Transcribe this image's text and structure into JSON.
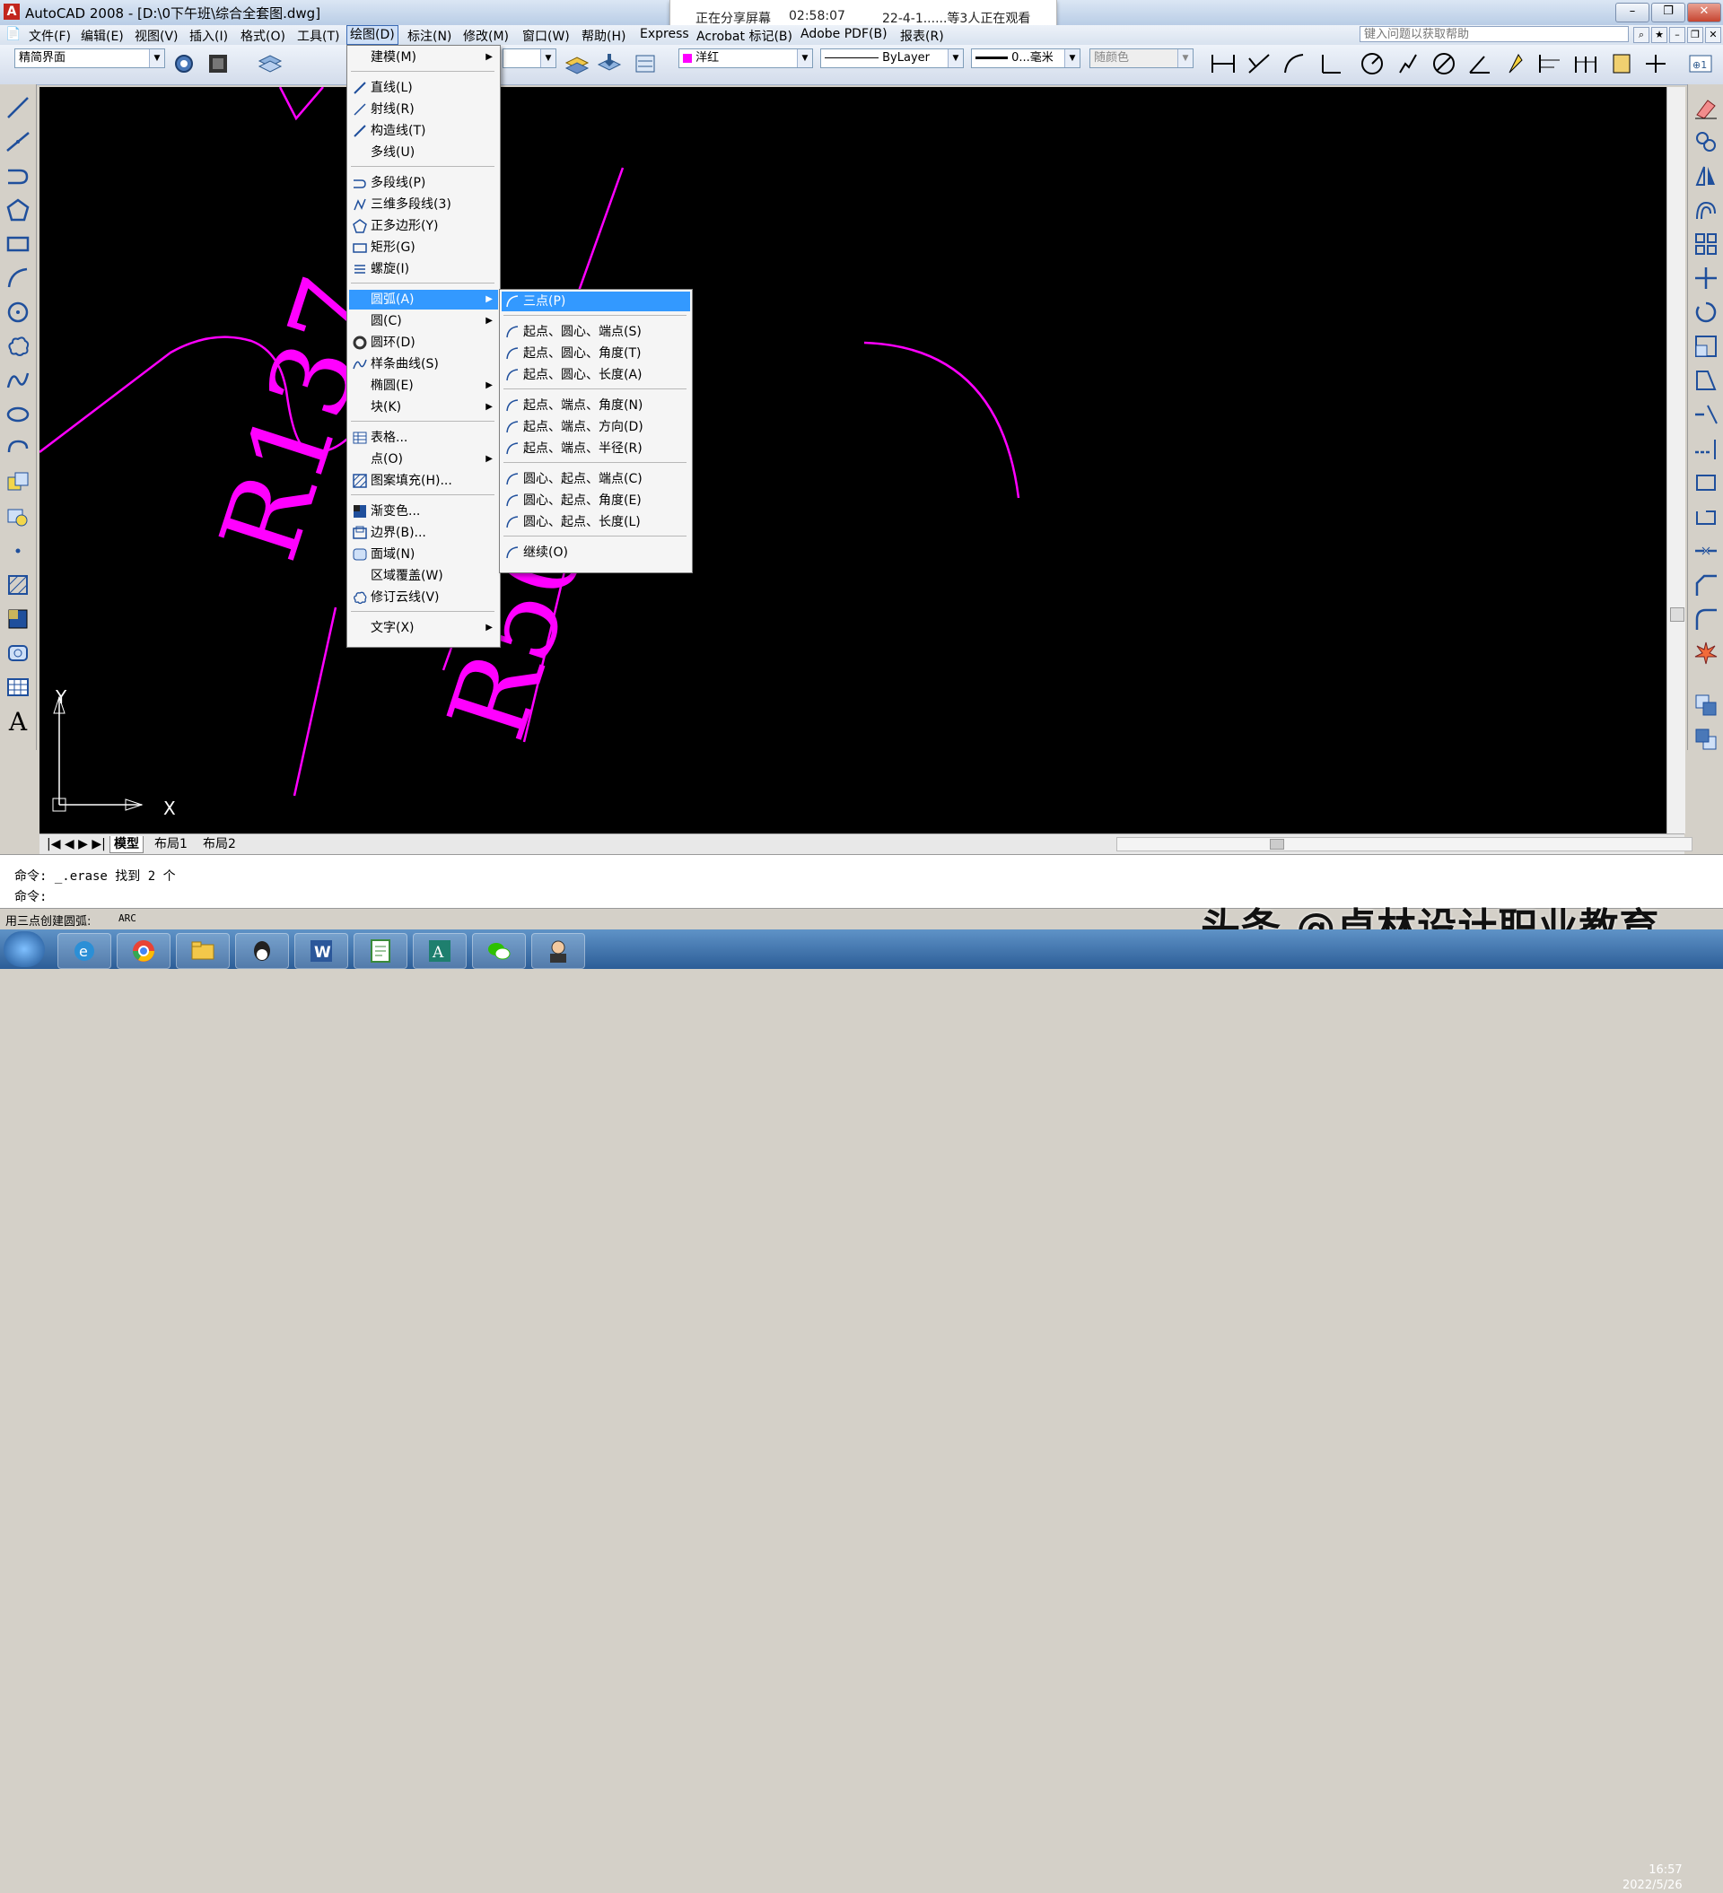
{
  "window": {
    "title": "AutoCAD 2008 - [D:\\0下午班\\综合全套图.dwg]",
    "buttons": [
      "–",
      "❐",
      "✕"
    ]
  },
  "share_banner": {
    "status": "正在分享屏幕",
    "time": "02:58:07",
    "viewers": "22-4-1......等3人正在观看"
  },
  "menubar": {
    "items": [
      "文件(F)",
      "编辑(E)",
      "视图(V)",
      "插入(I)",
      "格式(O)",
      "工具(T)",
      "绘图(D)",
      "标注(N)",
      "修改(M)",
      "窗口(W)",
      "帮助(H)",
      "Express",
      "Acrobat 标记(B)",
      "Adobe PDF(B)",
      "报表(R)"
    ],
    "help_placeholder": "键入问题以获取帮助"
  },
  "toolbar": {
    "workspace": "精简界面",
    "color": "洋红",
    "linetype": "ByLayer",
    "lineweight": "0...毫米",
    "plotstyle": "随颜色"
  },
  "draw_menu": {
    "items": [
      {
        "label": "建模(M)",
        "submenu": true
      },
      {
        "label": "直线(L)",
        "icon": "line-icon"
      },
      {
        "label": "射线(R)",
        "icon": "ray-icon"
      },
      {
        "label": "构造线(T)",
        "icon": "xline-icon"
      },
      {
        "label": "多线(U)"
      },
      {
        "label": "多段线(P)",
        "icon": "polyline-icon"
      },
      {
        "label": "三维多段线(3)",
        "icon": "3dpolyline-icon"
      },
      {
        "label": "正多边形(Y)",
        "icon": "polygon-icon"
      },
      {
        "label": "矩形(G)",
        "icon": "rectangle-icon"
      },
      {
        "label": "螺旋(I)",
        "icon": "helix-icon"
      },
      {
        "label": "圆弧(A)",
        "submenu": true,
        "highlighted": true
      },
      {
        "label": "圆(C)",
        "submenu": true
      },
      {
        "label": "圆环(D)",
        "icon": "donut-icon"
      },
      {
        "label": "样条曲线(S)",
        "icon": "spline-icon"
      },
      {
        "label": "椭圆(E)",
        "submenu": true
      },
      {
        "label": "块(K)",
        "submenu": true
      },
      {
        "label": "表格...",
        "icon": "table-icon"
      },
      {
        "label": "点(O)",
        "submenu": true
      },
      {
        "label": "图案填充(H)...",
        "icon": "hatch-icon"
      },
      {
        "label": "渐变色...",
        "icon": "gradient-icon"
      },
      {
        "label": "边界(B)...",
        "icon": "boundary-icon"
      },
      {
        "label": "面域(N)",
        "icon": "region-icon"
      },
      {
        "label": "区域覆盖(W)"
      },
      {
        "label": "修订云线(V)",
        "icon": "revcloud-icon"
      },
      {
        "label": "文字(X)",
        "submenu": true
      }
    ]
  },
  "arc_menu": {
    "items": [
      "三点(P)",
      "起点、圆心、端点(S)",
      "起点、圆心、角度(T)",
      "起点、圆心、长度(A)",
      "起点、端点、角度(N)",
      "起点、端点、方向(D)",
      "起点、端点、半径(R)",
      "圆心、起点、端点(C)",
      "圆心、起点、角度(E)",
      "圆心、起点、长度(L)",
      "继续(O)"
    ]
  },
  "drawing": {
    "text_r137": "R137",
    "text_r50": "R50",
    "axis_x": "X",
    "axis_y": "Y",
    "color": "#ff00ff"
  },
  "tabs": [
    "模型",
    "布局1",
    "布局2"
  ],
  "command": {
    "line1": "命令: _.erase 找到 2 个",
    "line2": "命令:"
  },
  "status": {
    "text": "用三点创建圆弧:",
    "cmd": "ARC"
  },
  "taskbar": {
    "apps": [
      "ie-icon",
      "chrome-icon",
      "folder-icon",
      "qq-icon",
      "word-icon",
      "notepad-icon",
      "autocad-icon",
      "wechat-icon",
      "avatar-icon"
    ],
    "time": "16:57",
    "date": "2022/5/26"
  },
  "watermark": "头条 @卓林设计职业教育"
}
